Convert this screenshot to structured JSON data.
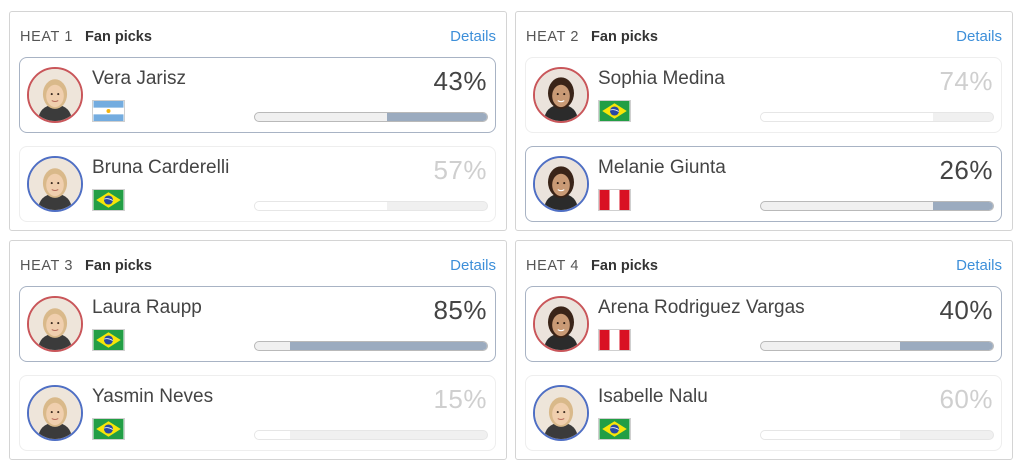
{
  "heats": [
    {
      "label": "HEAT 1",
      "fan_label": "Fan picks",
      "details_label": "Details",
      "surfers": [
        {
          "name": "Vera Jarisz",
          "percent": "43%",
          "value": 43,
          "flag": "argentina-flag",
          "leading": true,
          "ring": "red"
        },
        {
          "name": "Bruna Carderelli",
          "percent": "57%",
          "value": 57,
          "flag": "brazil-flag",
          "leading": false,
          "ring": "blue"
        }
      ]
    },
    {
      "label": "HEAT 2",
      "fan_label": "Fan picks",
      "details_label": "Details",
      "surfers": [
        {
          "name": "Sophia Medina",
          "percent": "74%",
          "value": 74,
          "flag": "brazil-flag",
          "leading": false,
          "ring": "red"
        },
        {
          "name": "Melanie Giunta",
          "percent": "26%",
          "value": 26,
          "flag": "peru-flag",
          "leading": true,
          "ring": "blue"
        }
      ]
    },
    {
      "label": "HEAT 3",
      "fan_label": "Fan picks",
      "details_label": "Details",
      "surfers": [
        {
          "name": "Laura Raupp",
          "percent": "85%",
          "value": 85,
          "flag": "brazil-flag",
          "leading": true,
          "ring": "red"
        },
        {
          "name": "Yasmin Neves",
          "percent": "15%",
          "value": 15,
          "flag": "brazil-flag",
          "leading": false,
          "ring": "blue"
        }
      ]
    },
    {
      "label": "HEAT 4",
      "fan_label": "Fan picks",
      "details_label": "Details",
      "surfers": [
        {
          "name": "Arena Rodriguez Vargas",
          "percent": "40%",
          "value": 40,
          "flag": "peru-flag",
          "leading": true,
          "ring": "red"
        },
        {
          "name": "Isabelle Nalu",
          "percent": "60%",
          "value": 60,
          "flag": "brazil-flag",
          "leading": false,
          "ring": "blue"
        }
      ]
    }
  ],
  "colors": {
    "accent_link": "#3d8fd9",
    "bar_fill": "#9babbf",
    "ring_red": "#c9565a",
    "ring_blue": "#4f6fc4"
  }
}
